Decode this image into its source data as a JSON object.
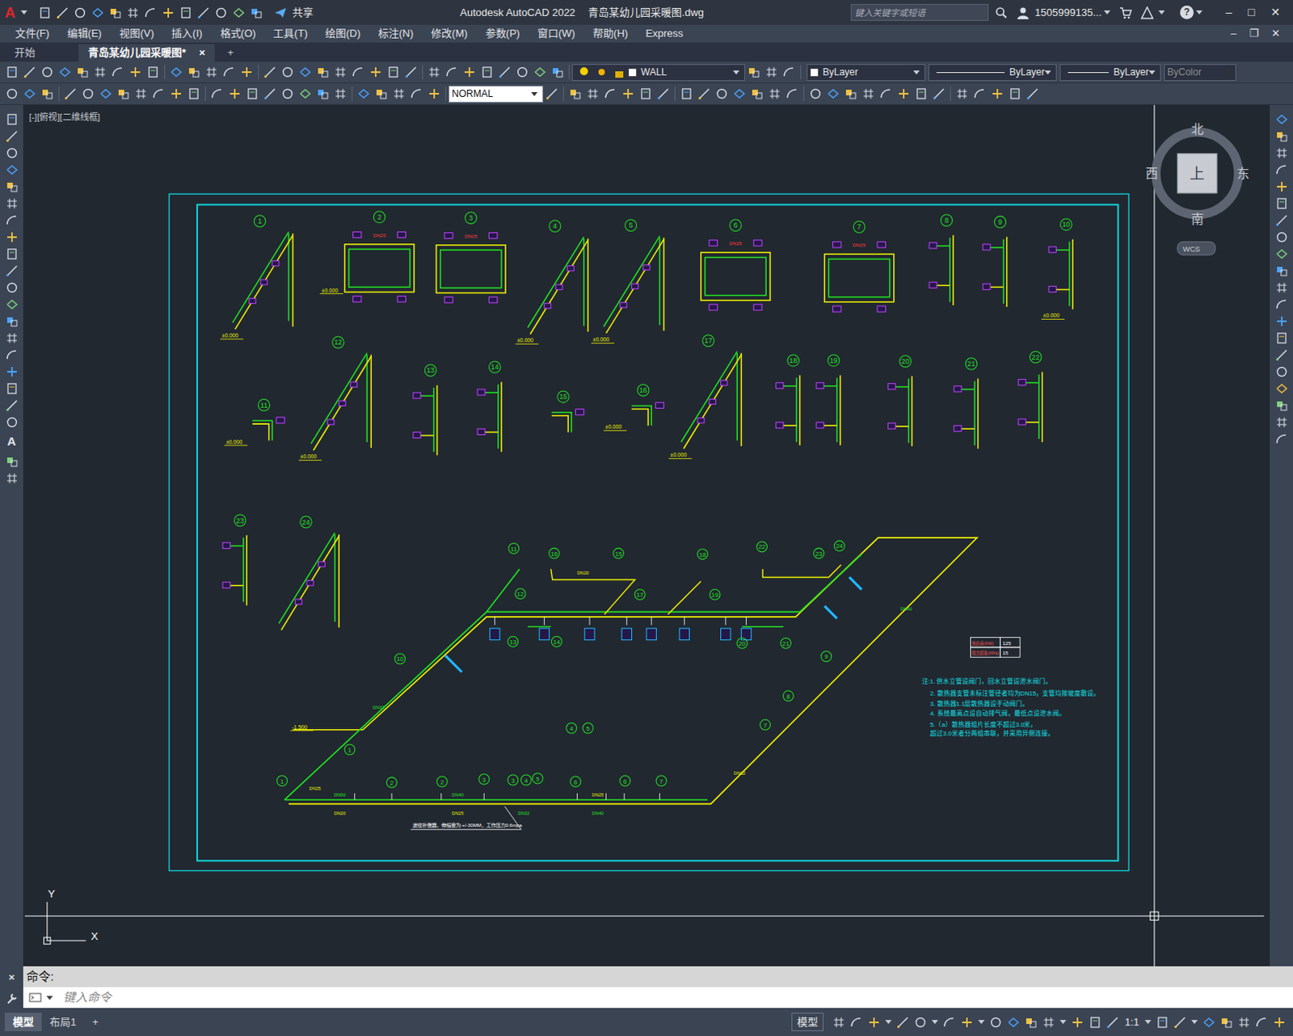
{
  "window": {
    "logo": "A",
    "share": "共享",
    "app": "Autodesk AutoCAD 2022",
    "file": "青岛某幼儿园采暖图.dwg",
    "search_placeholder": "键入关键字或短语",
    "user": "1505999135...",
    "help": "?",
    "controls": [
      "–",
      "□",
      "✕"
    ]
  },
  "menu": [
    "文件(F)",
    "编辑(E)",
    "视图(V)",
    "插入(I)",
    "格式(O)",
    "工具(T)",
    "绘图(D)",
    "标注(N)",
    "修改(M)",
    "参数(P)",
    "窗口(W)",
    "帮助(H)",
    "Express"
  ],
  "doc_controls": [
    "–",
    "❐",
    "✕"
  ],
  "doc_tabs": [
    {
      "label": "开始",
      "selected": false
    },
    {
      "label": "青岛某幼儿园采暖图*",
      "selected": true,
      "close": "×"
    }
  ],
  "new_tab": "+",
  "toolbar": {
    "layer": "WALL",
    "color": "ByLayer",
    "linetype": "ByLayer",
    "lineweight": "ByLayer",
    "plotstyle": "ByColor",
    "plotstyle_disabled": true,
    "textstyle": "NORMAL"
  },
  "left_toolbar": {
    "text_tool": "A"
  },
  "viewport": {
    "label": "[-][俯视][二维线框]"
  },
  "viewcube": {
    "north": "北",
    "south": "南",
    "west": "西",
    "east": "东",
    "face": "上",
    "ucs": "WCS"
  },
  "drawing": {
    "details": [
      {
        "label": "1",
        "kind": "diagonal",
        "elev": "±0.000"
      },
      {
        "label": "2",
        "kind": "loop",
        "pipe": "DN25",
        "elev": "±0.000"
      },
      {
        "label": "3",
        "kind": "loop",
        "pipe": "DN25"
      },
      {
        "label": "4",
        "kind": "diagonal",
        "elev": "±0.000"
      },
      {
        "label": "5",
        "kind": "diagonal",
        "elev": "±0.000"
      },
      {
        "label": "6",
        "kind": "loop",
        "pipe": "DN25"
      },
      {
        "label": "7",
        "kind": "loop",
        "pipe": "DN25"
      },
      {
        "label": "8",
        "kind": "riser"
      },
      {
        "label": "9",
        "kind": "riser"
      },
      {
        "label": "10",
        "kind": "riser",
        "elev": "±0.000"
      },
      {
        "label": "11",
        "kind": "branch",
        "elev": "±0.000"
      },
      {
        "label": "12",
        "kind": "diagonal",
        "elev": "±0.000"
      },
      {
        "label": "13",
        "kind": "riser"
      },
      {
        "label": "14",
        "kind": "riser"
      },
      {
        "label": "15",
        "kind": "branch"
      },
      {
        "label": "16",
        "kind": "branch",
        "elev": "±0.000"
      },
      {
        "label": "17",
        "kind": "diagonal",
        "elev": "±0.000"
      },
      {
        "label": "18",
        "kind": "riser"
      },
      {
        "label": "19",
        "kind": "riser"
      },
      {
        "label": "20",
        "kind": "riser"
      },
      {
        "label": "21",
        "kind": "riser"
      },
      {
        "label": "22",
        "kind": "riser"
      },
      {
        "label": "23",
        "kind": "riser"
      },
      {
        "label": "24",
        "kind": "diagonal"
      }
    ],
    "iso_labels": [
      "11",
      "16",
      "15",
      "18",
      "22",
      "23",
      "24",
      "12",
      "17",
      "19",
      "13",
      "14",
      "20",
      "21",
      "10",
      "9",
      "8",
      "7",
      "1",
      "4",
      "5",
      "1",
      "2",
      "2",
      "3",
      "3",
      "4",
      "5",
      "6",
      "6",
      "7"
    ],
    "pipe_labels": [
      "DN50",
      "DN20",
      "DN40",
      "DN25",
      "DN32",
      "DN25",
      "DN40",
      "DN32",
      "DN40",
      "DN20",
      "DN32",
      "DN25"
    ],
    "iso_elevation": "-1.500",
    "load_table": [
      [
        "热负荷(KW)",
        "125"
      ],
      [
        "阻力损失(KPa)",
        "15"
      ]
    ],
    "notes": [
      "注:1. 供水立管设阀门，回水立管设泄水阀门。",
      "2. 散热器支管未标注管径者均为DN15，支管均按坡度敷设。",
      "3. 散热器1.1层散热器设手动阀门。",
      "4. 系统最高点设自动排气阀，最低点设泄水阀。",
      "5.（a）散热器组片长度不超过3.0米，",
      "超过3.0米者分两组串联，并采用异侧连接。"
    ],
    "compensator_note": "波纹补偿器，伸缩量为:+/-30MM，工作压力0.6mpa"
  },
  "ucs_icon": {
    "x": "X",
    "y": "Y"
  },
  "command": {
    "close": "×",
    "history": "命令:",
    "placeholder": "键入命令"
  },
  "layout_tabs": [
    {
      "label": "模型",
      "selected": true
    },
    {
      "label": "布局1",
      "selected": false
    }
  ],
  "layout_add": "+",
  "status_bar": {
    "model": "模型",
    "scale": "1:1"
  }
}
